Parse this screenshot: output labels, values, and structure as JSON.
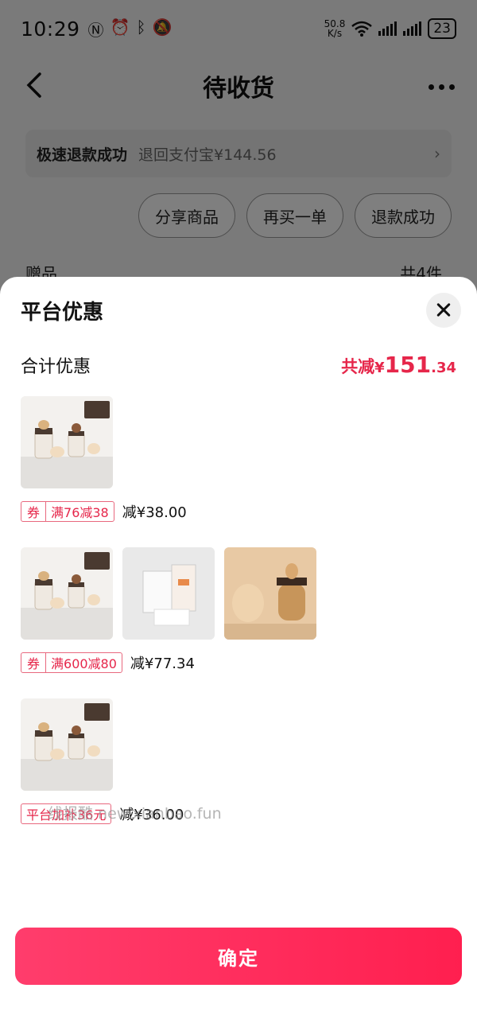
{
  "status_bar": {
    "time": "10:29",
    "speed": "50.8",
    "speed_unit": "K/s",
    "battery": "23"
  },
  "nav": {
    "title": "待收货"
  },
  "refund_notice": {
    "label": "极速退款成功",
    "detail": "退回支付宝¥144.56"
  },
  "actions": [
    "分享商品",
    "再买一单",
    "退款成功"
  ],
  "gift": {
    "label": "赠品",
    "count": "共4件"
  },
  "sheet": {
    "title": "平台优惠",
    "total_label": "合计优惠",
    "total_prefix": "共减",
    "total_currency": "¥",
    "total_int": "151",
    "total_dec": ".34",
    "groups": [
      {
        "tag_type": "券",
        "tag_text": "满76减38",
        "saving": "减¥38.00"
      },
      {
        "tag_type": "券",
        "tag_text": "满600减80",
        "saving": "减¥77.34"
      },
      {
        "tag_text": "平台加补36元",
        "saving": "减¥36.00"
      }
    ],
    "confirm_label": "确定",
    "watermark": "线报酷 new.xianbao.fun"
  },
  "colors": {
    "accent": "#e6264a",
    "confirm_start": "#ff3d6c",
    "confirm_end": "#ff1f4f"
  },
  "icons": [
    "nfc-icon",
    "alarm-icon",
    "bluetooth-icon",
    "mute-icon",
    "wifi-icon",
    "signal-icon",
    "battery-icon",
    "back-icon",
    "more-icon",
    "chevron-right-icon",
    "close-icon"
  ]
}
